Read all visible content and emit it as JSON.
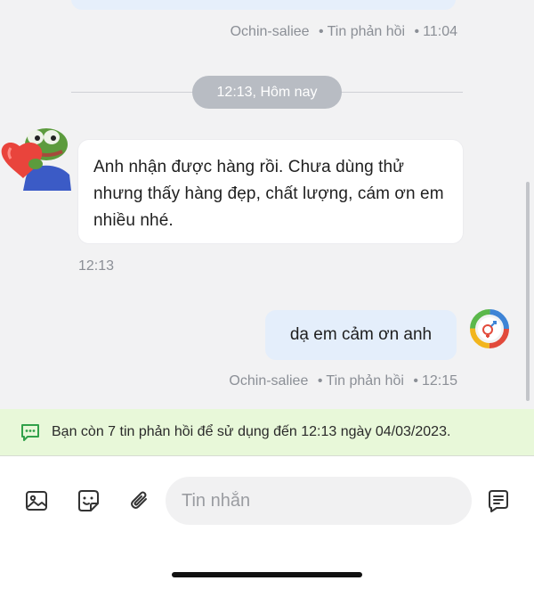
{
  "messages": {
    "first_meta": {
      "sender": "Ochin-saliee",
      "type": "Tin phản hồi",
      "time": "11:04"
    },
    "date_divider": "12:13, Hôm nay",
    "incoming": {
      "text": "Anh nhận được hàng rồi. Chưa dùng thử nhưng thấy hàng đẹp, chất lượng, cám ơn em nhiều nhé.",
      "time": "12:13"
    },
    "outgoing": {
      "text": "dạ em cảm ơn anh",
      "sender": "Ochin-saliee",
      "type": "Tin phản hồi",
      "time": "12:15"
    },
    "separator": "•"
  },
  "banner": {
    "text": "Bạn còn 7 tin phản hồi để sử dụng đến 12:13 ngày 04/03/2023.",
    "icon": "chat-bubble-icon",
    "color": "#31a14a"
  },
  "composer": {
    "placeholder": "Tin nhắn",
    "icons": [
      "image-icon",
      "sticker-icon",
      "attachment-icon",
      "quick-reply-icon"
    ]
  }
}
